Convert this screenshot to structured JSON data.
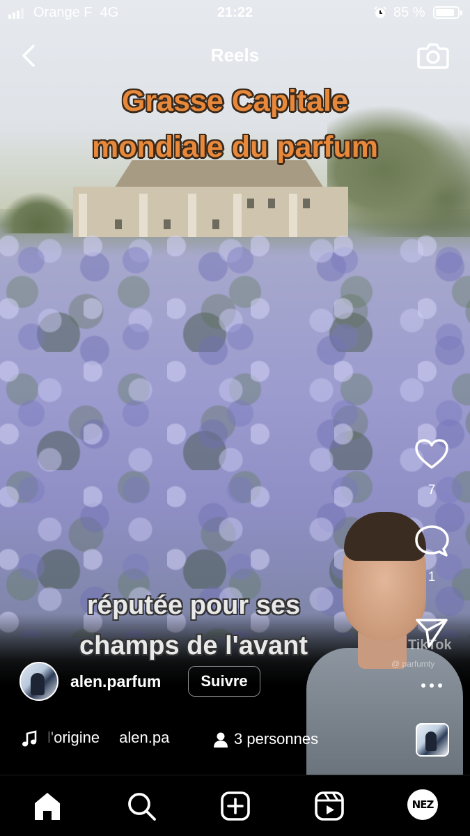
{
  "status_bar": {
    "carrier": "Orange F",
    "network": "4G",
    "time": "21:22",
    "battery_percent": "85 %",
    "battery_level": 0.85,
    "icons": [
      "signal-bars-icon",
      "alarm-icon",
      "battery-icon"
    ]
  },
  "header": {
    "title": "Reels",
    "back_icon": "chevron-left-icon",
    "camera_icon": "camera-icon"
  },
  "video": {
    "caption_top_line1": "Grasse Capitale",
    "caption_top_line2": "mondiale du parfum",
    "caption_bottom_line1": "réputée pour ses",
    "caption_bottom_line2": "champs de l'avant",
    "watermark_brand": "TikTok",
    "watermark_handle": "@ parfumty"
  },
  "actions": {
    "like_icon": "heart-outline-icon",
    "like_count": "7",
    "comment_icon": "comment-bubble-icon",
    "comment_count": "1",
    "share_icon": "paper-plane-icon",
    "more_icon": "more-horizontal-icon"
  },
  "author": {
    "username": "alen.parfum",
    "follow_label": "Suivre"
  },
  "audio": {
    "music_icon": "music-note-icon",
    "marquee_part1": "l'origine",
    "marquee_part2": "alen.pa",
    "people_icon": "person-icon",
    "people_text": "3 personnes"
  },
  "tab_bar": {
    "items": [
      "home-icon",
      "search-icon",
      "create-plus-icon",
      "reels-icon",
      "profile-avatar"
    ],
    "profile_label": "NEZ",
    "active": "home-icon"
  }
}
